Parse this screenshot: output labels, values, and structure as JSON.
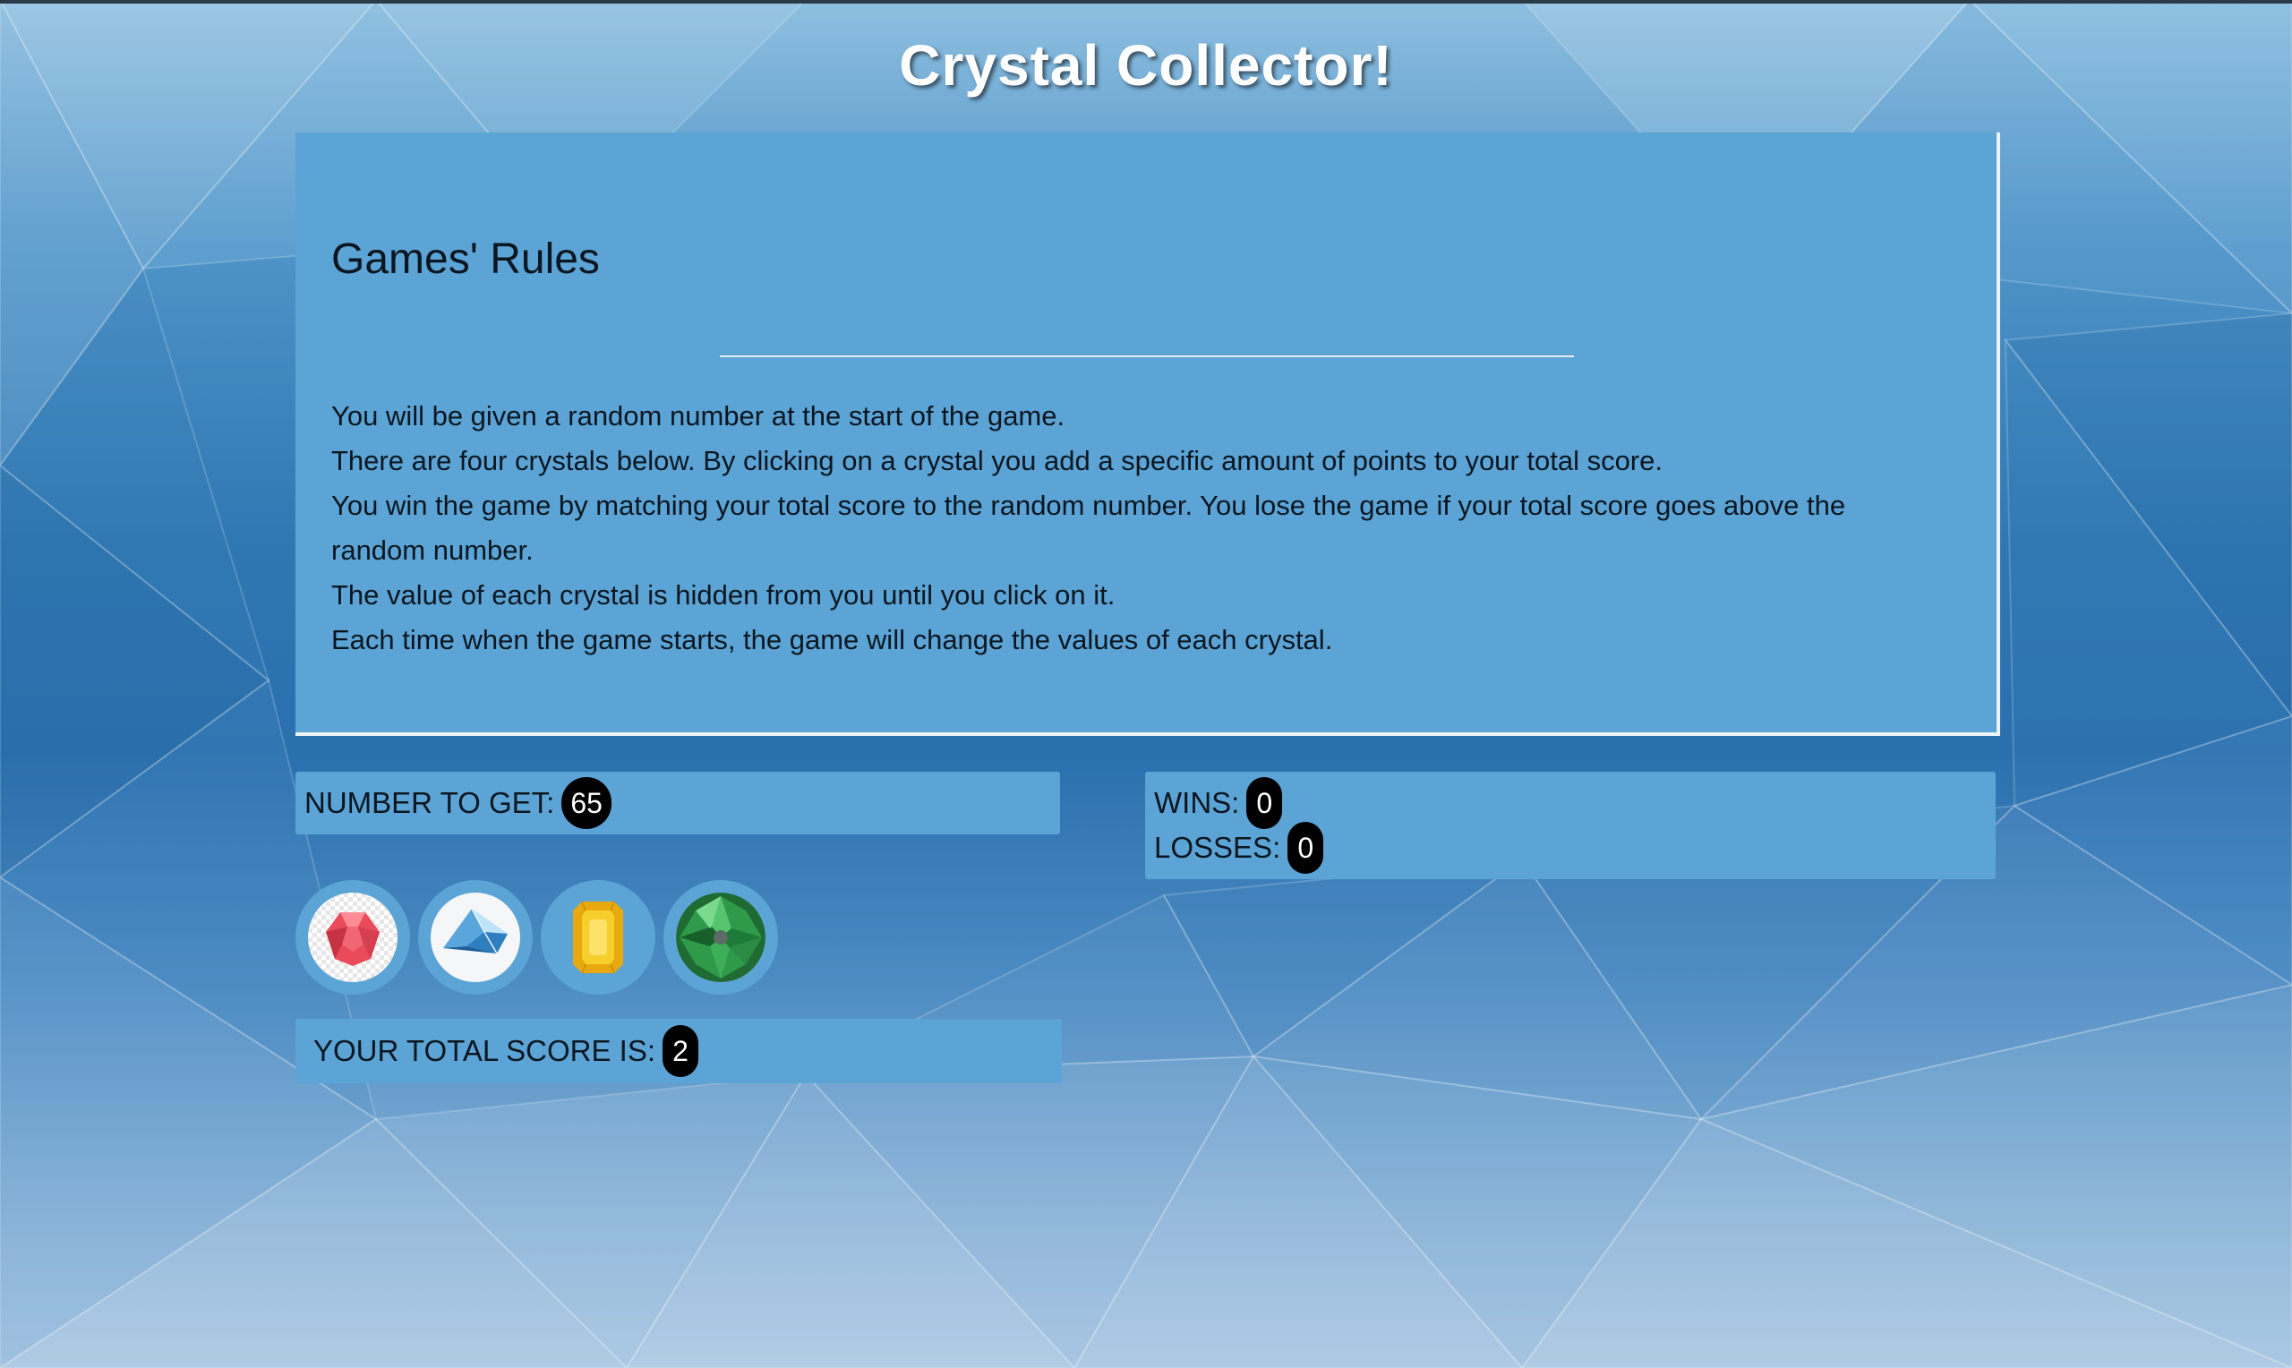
{
  "header": {
    "title": "Crystal Collector!"
  },
  "rules": {
    "heading": "Games' Rules",
    "items": [
      "You will be given a random number at the start of the game.",
      "There are four crystals below. By clicking on a crystal you add a specific amount of points to your total score.",
      "You win the game by matching your total score to the random number. You lose the game if your total score goes above the random number.",
      "The value of each crystal is hidden from you until you click on it.",
      "Each time when the game starts, the game will change the values of each crystal."
    ]
  },
  "target": {
    "label": "NUMBER TO GET:",
    "value": "65"
  },
  "record": {
    "wins_label": "WINS:",
    "wins": "0",
    "losses_label": "LOSSES:",
    "losses": "0"
  },
  "crystals": [
    {
      "icon": "red-crystal-icon",
      "color": "#e94b5a"
    },
    {
      "icon": "blue-diamond-icon",
      "color": "#6fb6e8"
    },
    {
      "icon": "yellow-crystal-icon",
      "color": "#f2c21a"
    },
    {
      "icon": "green-crystal-icon",
      "color": "#2e9a4a"
    }
  ],
  "score": {
    "label": "YOUR TOTAL SCORE IS:",
    "value": "2"
  },
  "theme": {
    "panel": "#5ba4d5",
    "badge": "#000000"
  }
}
